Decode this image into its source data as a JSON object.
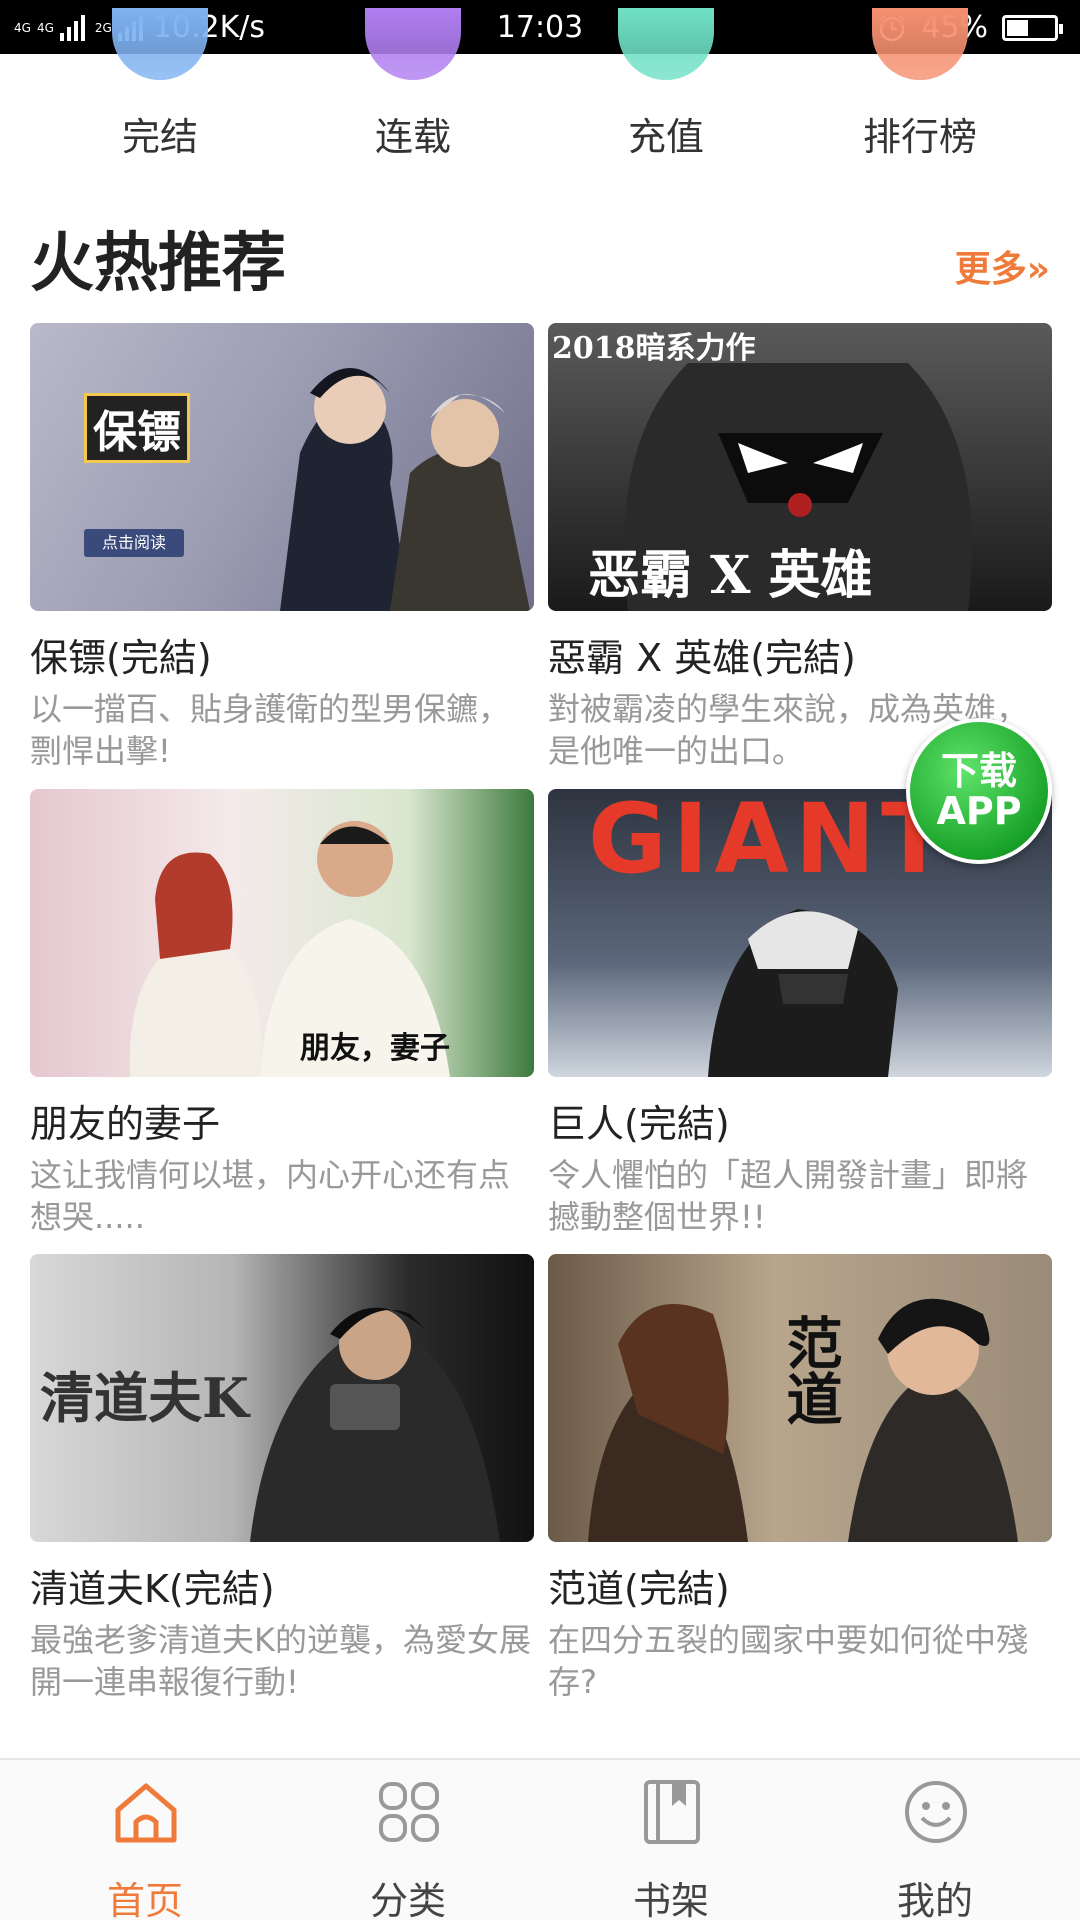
{
  "status_bar": {
    "network_1": "4G",
    "network_2": "4G",
    "network_3": "2G",
    "speed": "10.2K/s",
    "time": "17:03",
    "battery_percent": "45%",
    "battery_level": 0.45
  },
  "quick_nav": [
    {
      "label": "完结",
      "color": "#7fb2f0"
    },
    {
      "label": "连载",
      "color": "#b07ef0"
    },
    {
      "label": "充值",
      "color": "#6fe0c6"
    },
    {
      "label": "排行榜",
      "color": "#f59070"
    }
  ],
  "section": {
    "title": "火热推荐",
    "more": "更多»"
  },
  "comics": [
    {
      "title": "保镖(完結)",
      "desc": "以一擋百、貼身護衛的型男保鑣，剽悍出擊!",
      "cover_text": "保镖",
      "cover_button": "点击阅读"
    },
    {
      "title": "惡霸 X 英雄(完結)",
      "desc": "對被霸凌的學生來說，成為英雄，是他唯一的出口。",
      "cover_text": "恶霸 X 英雄",
      "cover_top": "2018暗系力作"
    },
    {
      "title": "朋友的妻子",
      "desc": "这让我情何以堪，内心开心还有点想哭.....",
      "cover_text": "朋友，妻子"
    },
    {
      "title": "巨人(完結)",
      "desc": "令人懼怕的「超人開發計畫」即將撼動整個世界!!",
      "cover_text": "GIANT"
    },
    {
      "title": "清道夫K(完結)",
      "desc": "最強老爹清道夫K的逆襲，為愛女展開一連串報復行動!",
      "cover_text": "清道夫K"
    },
    {
      "title": "范道(完結)",
      "desc": "在四分五裂的國家中要如何從中殘存?",
      "cover_text": "范道"
    }
  ],
  "download_badge": {
    "line1": "下载",
    "line2": "APP"
  },
  "tab_bar": [
    {
      "label": "首页",
      "icon": "home-icon",
      "active": true
    },
    {
      "label": "分类",
      "icon": "grid-icon",
      "active": false
    },
    {
      "label": "书架",
      "icon": "bookshelf-icon",
      "active": false
    },
    {
      "label": "我的",
      "icon": "smile-icon",
      "active": false
    }
  ],
  "colors": {
    "accent": "#f07a3a",
    "badge_green": "#1aa32a"
  }
}
